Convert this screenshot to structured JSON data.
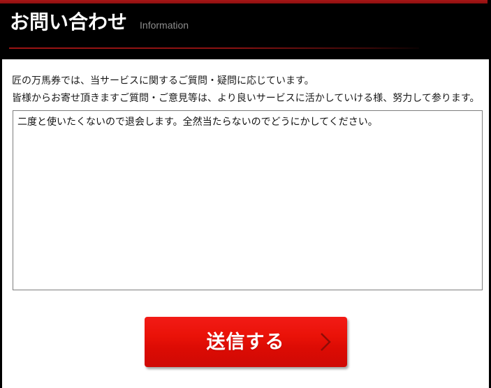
{
  "header": {
    "title": "お問い合わせ",
    "subtitle": "Information",
    "bar_color": "#9e1515",
    "background_color": "#000000",
    "divider_color": "#9d1414"
  },
  "intro": {
    "line1": "匠の万馬券では、当サービスに関するご質問・疑問に応じています。",
    "line2": "皆様からお寄せ頂きますご質問・ご意見等は、より良いサービスに活かしていける様、努力して参ります。"
  },
  "message": {
    "value": "二度と使いたくないので退会します。全然当たらないのでどうにかしてください。",
    "placeholder": ""
  },
  "submit": {
    "label": "送信する",
    "icon": "chevron-right-icon",
    "color": "#e51208"
  }
}
